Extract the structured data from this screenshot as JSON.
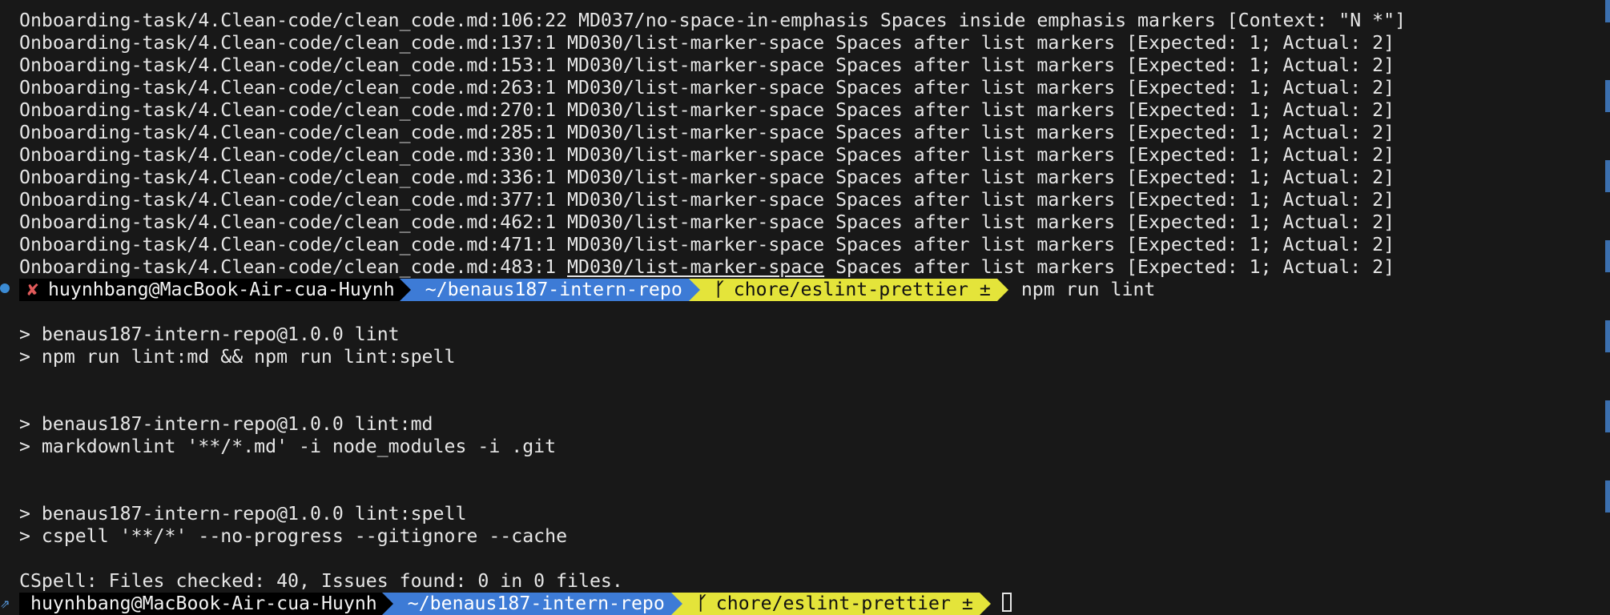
{
  "lint_errors": [
    "Onboarding-task/4.Clean-code/clean_code.md:106:22 MD037/no-space-in-emphasis Spaces inside emphasis markers [Context: \"N *\"]",
    "Onboarding-task/4.Clean-code/clean_code.md:137:1 MD030/list-marker-space Spaces after list markers [Expected: 1; Actual: 2]",
    "Onboarding-task/4.Clean-code/clean_code.md:153:1 MD030/list-marker-space Spaces after list markers [Expected: 1; Actual: 2]",
    "Onboarding-task/4.Clean-code/clean_code.md:263:1 MD030/list-marker-space Spaces after list markers [Expected: 1; Actual: 2]",
    "Onboarding-task/4.Clean-code/clean_code.md:270:1 MD030/list-marker-space Spaces after list markers [Expected: 1; Actual: 2]",
    "Onboarding-task/4.Clean-code/clean_code.md:285:1 MD030/list-marker-space Spaces after list markers [Expected: 1; Actual: 2]",
    "Onboarding-task/4.Clean-code/clean_code.md:330:1 MD030/list-marker-space Spaces after list markers [Expected: 1; Actual: 2]",
    "Onboarding-task/4.Clean-code/clean_code.md:336:1 MD030/list-marker-space Spaces after list markers [Expected: 1; Actual: 2]",
    "Onboarding-task/4.Clean-code/clean_code.md:377:1 MD030/list-marker-space Spaces after list markers [Expected: 1; Actual: 2]",
    "Onboarding-task/4.Clean-code/clean_code.md:462:1 MD030/list-marker-space Spaces after list markers [Expected: 1; Actual: 2]",
    "Onboarding-task/4.Clean-code/clean_code.md:471:1 MD030/list-marker-space Spaces after list markers [Expected: 1; Actual: 2]"
  ],
  "last_error": {
    "prefix": "Onboarding-task/4.Clean-code/clean_code.md:483:1 ",
    "rule": "MD030/list-marker-space",
    "suffix": " Spaces after list markers [Expected: 1; Actual: 2]"
  },
  "prompt": {
    "status_icon": "✘",
    "user": "huynhbang@MacBook-Air-cua-Huynh",
    "directory": "~/benaus187-intern-repo",
    "branch_icon": "ᚴ",
    "branch": "chore/eslint-prettier ±",
    "command": "npm run lint"
  },
  "output": {
    "lint_header": "> benaus187-intern-repo@1.0.0 lint",
    "lint_cmd": "> npm run lint:md && npm run lint:spell",
    "md_header": "> benaus187-intern-repo@1.0.0 lint:md",
    "md_cmd": "> markdownlint '**/*.md' -i node_modules -i .git",
    "spell_header": "> benaus187-intern-repo@1.0.0 lint:spell",
    "spell_cmd": "> cspell '**/*' --no-progress --gitignore --cache",
    "cspell_result": "CSpell: Files checked: 40, Issues found: 0 in 0 files."
  },
  "prompt2": {
    "user": "huynhbang@MacBook-Air-cua-Huynh",
    "directory": "~/benaus187-intern-repo",
    "branch_icon": "ᚴ",
    "branch": "chore/eslint-prettier ±"
  },
  "colors": {
    "background": "#181818",
    "text": "#e6e6e6",
    "dir_segment": "#3d7bd6",
    "git_segment": "#e4e43a",
    "error_mark": "#e05a5a"
  }
}
